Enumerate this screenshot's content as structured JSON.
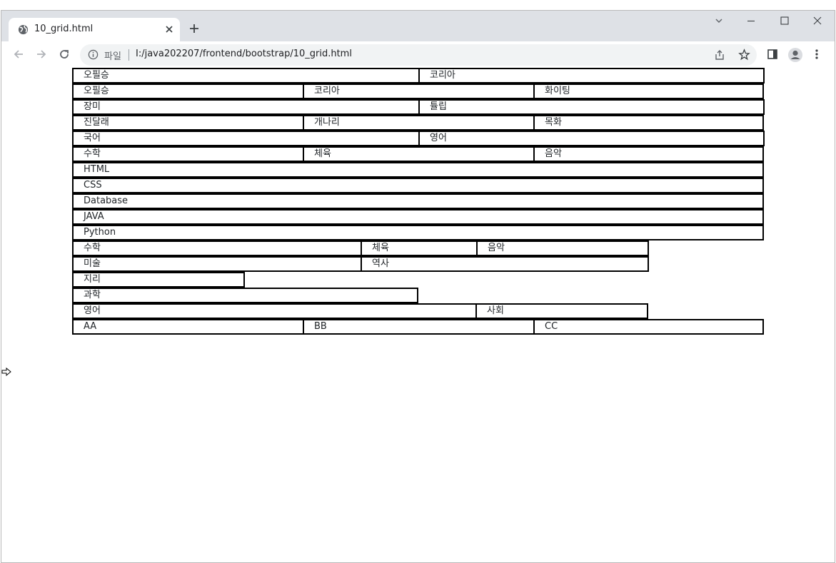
{
  "browser": {
    "tab_title": "10_grid.html",
    "scheme_label": "파일",
    "url": "I:/java202207/frontend/bootstrap/10_grid.html"
  },
  "rows": [
    [
      "오필승",
      "코리아"
    ],
    [
      "오필승",
      "코리아",
      "화이팅"
    ],
    [
      "장미",
      "튤립"
    ],
    [
      "진달래",
      "개나리",
      "목화"
    ],
    [
      "국어",
      "영어"
    ],
    [
      "수학",
      "체육",
      "음악"
    ],
    [
      "HTML"
    ],
    [
      "CSS"
    ],
    [
      "Database"
    ],
    [
      "JAVA"
    ],
    [
      "Python"
    ],
    [
      "수학",
      "체육",
      "음악"
    ],
    [
      "미술",
      "역사"
    ],
    [
      "지리"
    ],
    [
      "과학"
    ],
    [
      "영어",
      "사회"
    ],
    [
      "AA",
      "BB",
      "CC"
    ]
  ]
}
